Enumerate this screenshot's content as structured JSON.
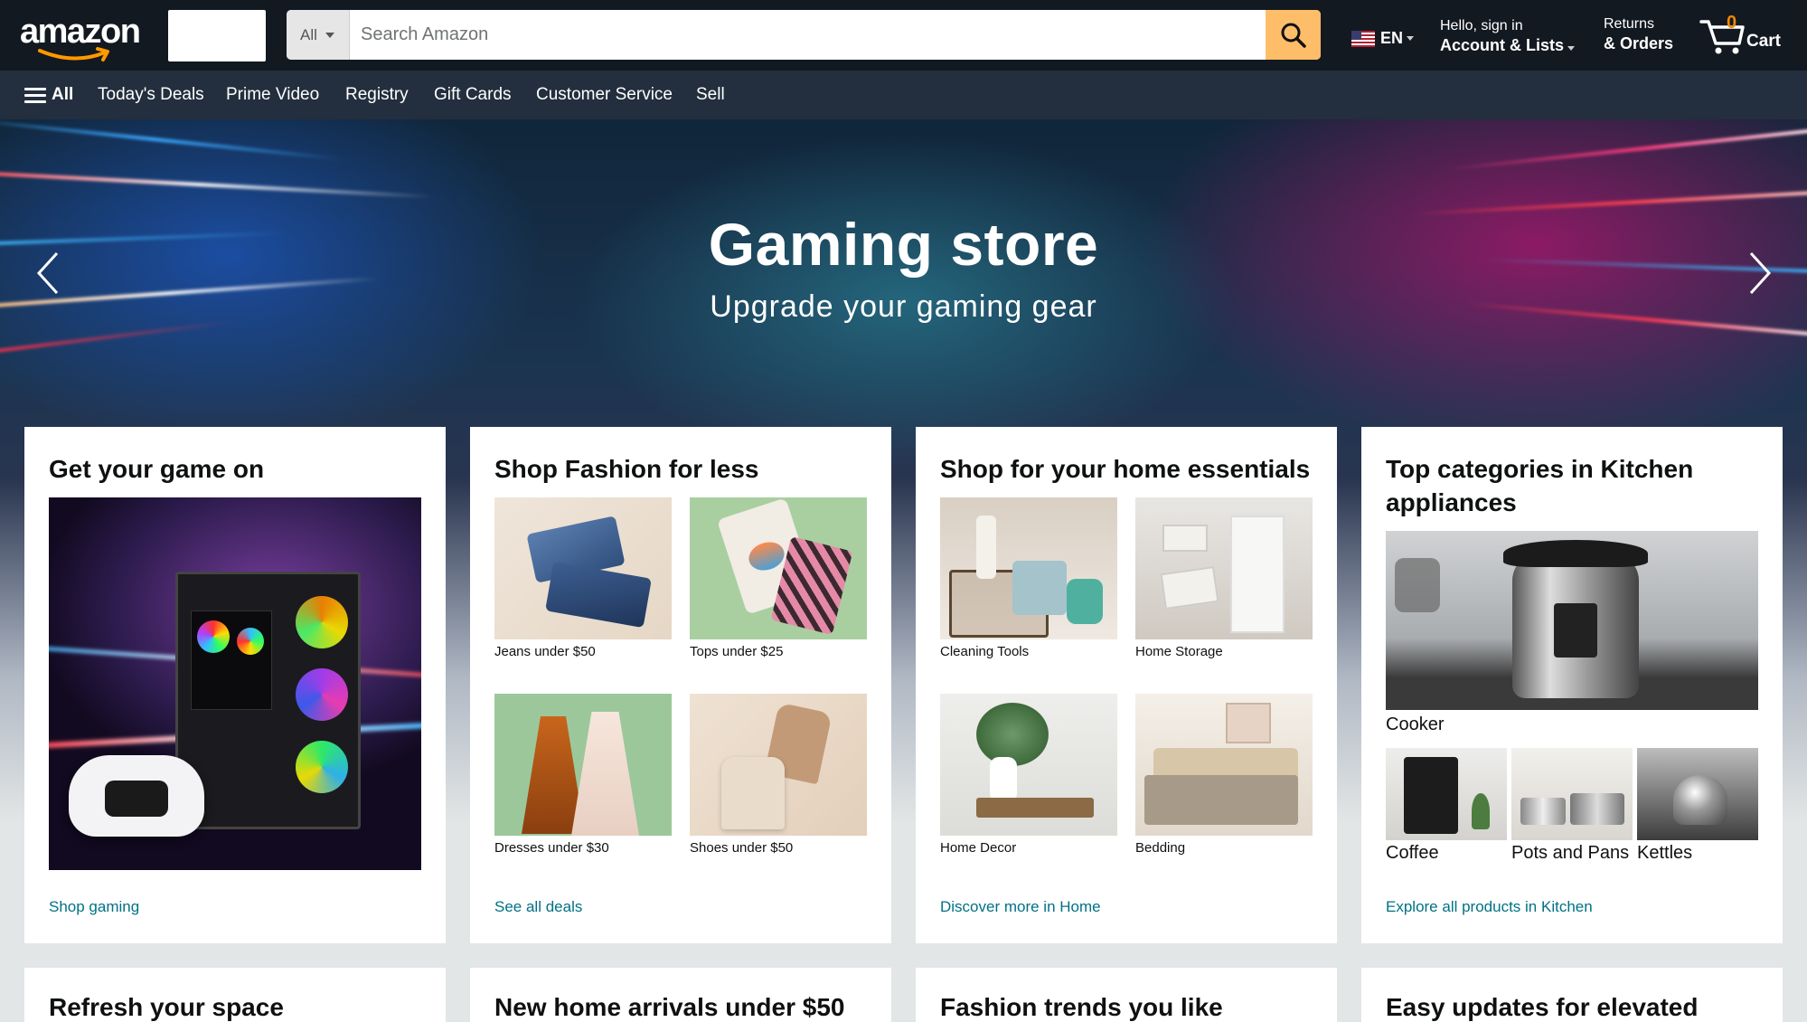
{
  "header": {
    "logo_text": "amazon",
    "search": {
      "category": "All",
      "placeholder": "Search Amazon"
    },
    "language": "EN",
    "account": {
      "line1": "Hello, sign in",
      "line2": "Account & Lists"
    },
    "returns": {
      "line1": "Returns",
      "line2": "& Orders"
    },
    "cart": {
      "count": "0",
      "label": "Cart"
    }
  },
  "subnav": {
    "all_label": "All",
    "items": [
      "Today's Deals",
      "Prime Video",
      "Registry",
      "Gift Cards",
      "Customer Service",
      "Sell"
    ]
  },
  "hero": {
    "title": "Gaming store",
    "subtitle": "Upgrade your gaming gear"
  },
  "cards": [
    {
      "title": "Get your game on",
      "link": "Shop gaming"
    },
    {
      "title": "Shop Fashion for less",
      "link": "See all deals",
      "tiles": [
        "Jeans under $50",
        "Tops under $25",
        "Dresses under $30",
        "Shoes under $50"
      ]
    },
    {
      "title": "Shop for your home essentials",
      "link": "Discover more in Home",
      "tiles": [
        "Cleaning Tools",
        "Home Storage",
        "Home Decor",
        "Bedding"
      ]
    },
    {
      "title": "Top categories in Kitchen appliances",
      "link": "Explore all products in Kitchen",
      "main_caption": "Cooker",
      "tiles": [
        "Coffee",
        "Pots and Pans",
        "Kettles"
      ]
    }
  ],
  "cards_row2": [
    "Refresh your space",
    "New home arrivals under $50",
    "Fashion trends you like",
    "Easy updates for elevated"
  ],
  "colors": {
    "nav_bg": "#131921",
    "subnav_bg": "#232f3e",
    "search_button": "#febd69",
    "link": "#007185",
    "cart_count": "#f08804"
  }
}
